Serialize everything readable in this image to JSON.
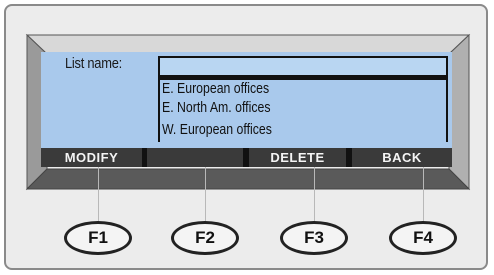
{
  "screen": {
    "list_label": "List name:",
    "name_field_value": "",
    "list_items": [
      "E. European offices",
      "E. North Am. offices",
      "W. European offices"
    ]
  },
  "softkeys": [
    {
      "label": "MODIFY"
    },
    {
      "label": ""
    },
    {
      "label": "DELETE"
    },
    {
      "label": "BACK"
    }
  ],
  "function_keys": [
    "F1",
    "F2",
    "F3",
    "F4"
  ],
  "colors": {
    "screen_bg": "#a9c9ec",
    "softkey_bg": "#3a3a3a",
    "device_bg": "#ececec"
  }
}
